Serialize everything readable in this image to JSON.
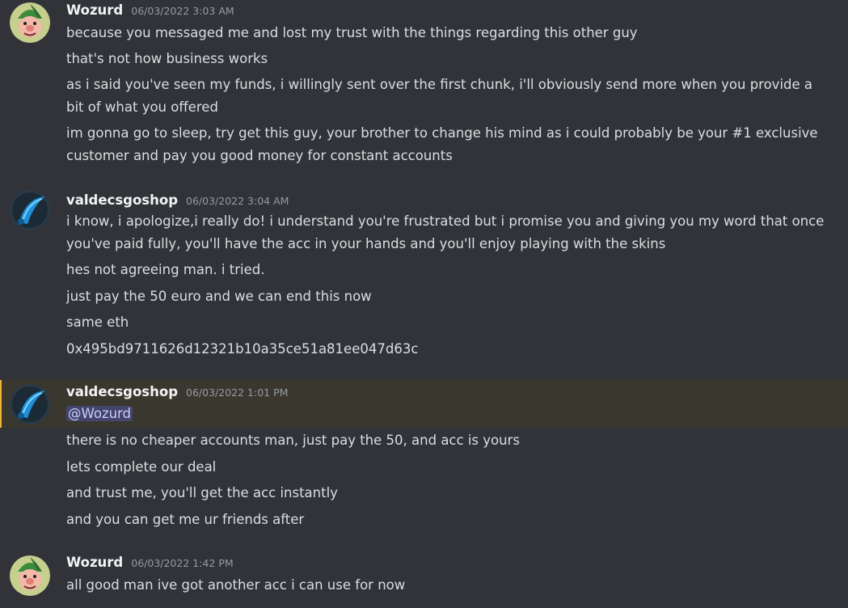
{
  "messages": [
    {
      "username": "Wozurd",
      "avatar_icon": "gnome-avatar-icon",
      "timestamp": "06/03/2022 3:03 AM",
      "lines": [
        "because you messaged me and lost my trust with the things regarding this other guy",
        "that's not how business works",
        "as i said you've seen my funds, i willingly sent over the first chunk, i'll obviously send more when you provide a bit of what you offered",
        "im gonna go to sleep, try get this guy, your brother to change his mind as i could probably be your #1 exclusive customer and pay you good money for constant accounts"
      ]
    },
    {
      "username": "valdecsgoshop",
      "avatar_icon": "blue-knife-avatar-icon",
      "timestamp": "06/03/2022 3:04 AM",
      "lines": [
        "i know, i apologize,i really do!  i understand you're frustrated but i promise you and giving you my word that once you've paid fully, you'll have the acc in your hands and you'll enjoy playing with the skins",
        "hes not agreeing man. i tried.",
        "just pay the 50 euro and we can end this now",
        "same eth",
        "0x495bd9711626d12321b10a35ce51a81ee047d63c"
      ]
    },
    {
      "username": "valdecsgoshop",
      "avatar_icon": "blue-knife-avatar-icon",
      "timestamp": "06/03/2022 1:01 PM",
      "mention": "@Wozurd",
      "lines": [
        "there is no cheaper accounts man, just pay the 50, and acc is yours",
        "lets complete our deal",
        "and trust me, you'll get the acc instantly",
        "and you can get me ur friends after"
      ]
    },
    {
      "username": "Wozurd",
      "avatar_icon": "gnome-avatar-icon",
      "timestamp": "06/03/2022 1:42 PM",
      "lines": [
        "all good man ive got another acc i can use for now"
      ]
    }
  ],
  "colors": {
    "background": "#313338",
    "highlight": "#3a372e",
    "mention_bg": "#5865f2",
    "username": "#f2f3f5",
    "timestamp": "#949ba4",
    "text": "#dbdee1"
  }
}
